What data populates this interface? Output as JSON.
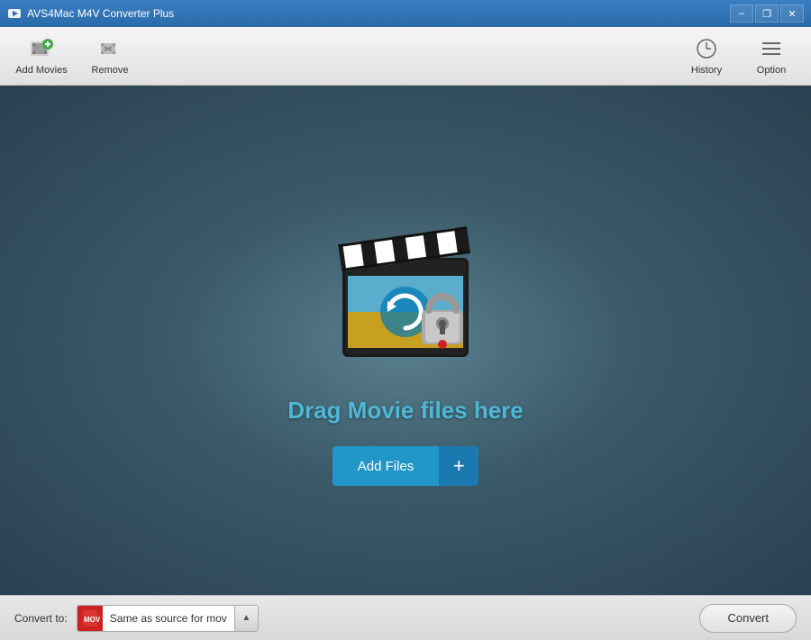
{
  "app": {
    "title": "AVS4Mac M4V Converter Plus",
    "icon": "video-icon"
  },
  "window_controls": {
    "minimize_label": "–",
    "restore_label": "❐",
    "close_label": "✕"
  },
  "toolbar": {
    "add_movies_label": "Add Movies",
    "remove_label": "Remove",
    "history_label": "History",
    "option_label": "Option"
  },
  "main": {
    "drag_text": "Drag Movie files here",
    "add_files_label": "Add Files",
    "add_files_plus": "+"
  },
  "bottom_bar": {
    "convert_to_label": "Convert to:",
    "format_text": "Same as source for mov",
    "convert_btn_label": "Convert"
  }
}
